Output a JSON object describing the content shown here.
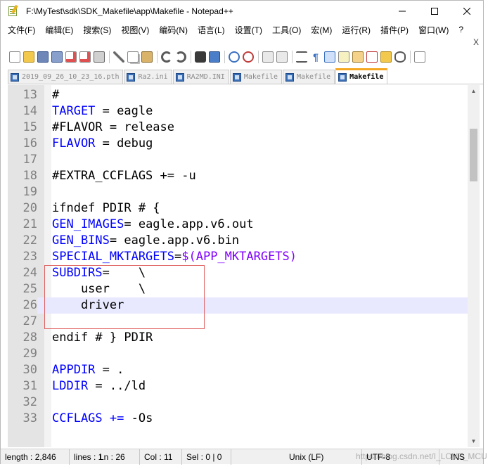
{
  "window": {
    "title": "F:\\MyTest\\sdk\\SDK_Makefile\\app\\Makefile - Notepad++"
  },
  "menu": {
    "items": [
      "文件(F)",
      "编辑(E)",
      "搜索(S)",
      "视图(V)",
      "编码(N)",
      "语言(L)",
      "设置(T)",
      "工具(O)",
      "宏(M)",
      "运行(R)",
      "插件(P)",
      "窗口(W)",
      "?"
    ],
    "close_label": "X"
  },
  "tabs": [
    {
      "label": "2019_09_26_10_23_16.pth",
      "active": false
    },
    {
      "label": "Ra2.ini",
      "active": false
    },
    {
      "label": "RA2MD.INI",
      "active": false
    },
    {
      "label": "Makefile",
      "active": false
    },
    {
      "label": "Makefile",
      "active": false
    },
    {
      "label": "Makefile",
      "active": true
    }
  ],
  "editor": {
    "current_line": 26,
    "lines": [
      {
        "num": "13",
        "text": "#"
      },
      {
        "num": "14",
        "text": "TARGET = eagle"
      },
      {
        "num": "15",
        "text": "#FLAVOR = release"
      },
      {
        "num": "16",
        "text": "FLAVOR = debug"
      },
      {
        "num": "17",
        "text": ""
      },
      {
        "num": "18",
        "text": "#EXTRA_CCFLAGS += -u"
      },
      {
        "num": "19",
        "text": ""
      },
      {
        "num": "20",
        "text": "ifndef PDIR # {"
      },
      {
        "num": "21",
        "text": "GEN_IMAGES= eagle.app.v6.out"
      },
      {
        "num": "22",
        "text": "GEN_BINS= eagle.app.v6.bin"
      },
      {
        "num": "23",
        "text": "SPECIAL_MKTARGETS=$(APP_MKTARGETS)"
      },
      {
        "num": "24",
        "text": "SUBDIRS=    \\"
      },
      {
        "num": "25",
        "text": "    user    \\"
      },
      {
        "num": "26",
        "text": "    driver"
      },
      {
        "num": "27",
        "text": ""
      },
      {
        "num": "28",
        "text": "endif # } PDIR"
      },
      {
        "num": "29",
        "text": ""
      },
      {
        "num": "30",
        "text": "APPDIR = ."
      },
      {
        "num": "31",
        "text": "LDDIR = ../ld"
      },
      {
        "num": "32",
        "text": ""
      },
      {
        "num": "33",
        "text": "CCFLAGS += -Os"
      }
    ]
  },
  "status": {
    "length": "length : 2,846",
    "lines": "lines : 1",
    "ln": "Ln : 26",
    "col": "Col : 11",
    "sel": "Sel : 0 | 0",
    "eol": "Unix (LF)",
    "encoding": "UTF-8",
    "mode": "INS"
  },
  "watermark": "https://blog.csdn.net/I_LOVE_MCU",
  "colors": {
    "keyword": "#0000ff",
    "comment": "#008000",
    "variable": "#8000ff",
    "current_line_bg": "#e8e8ff",
    "highlight_box": "#e06060",
    "active_tab_accent": "#f6a722"
  }
}
